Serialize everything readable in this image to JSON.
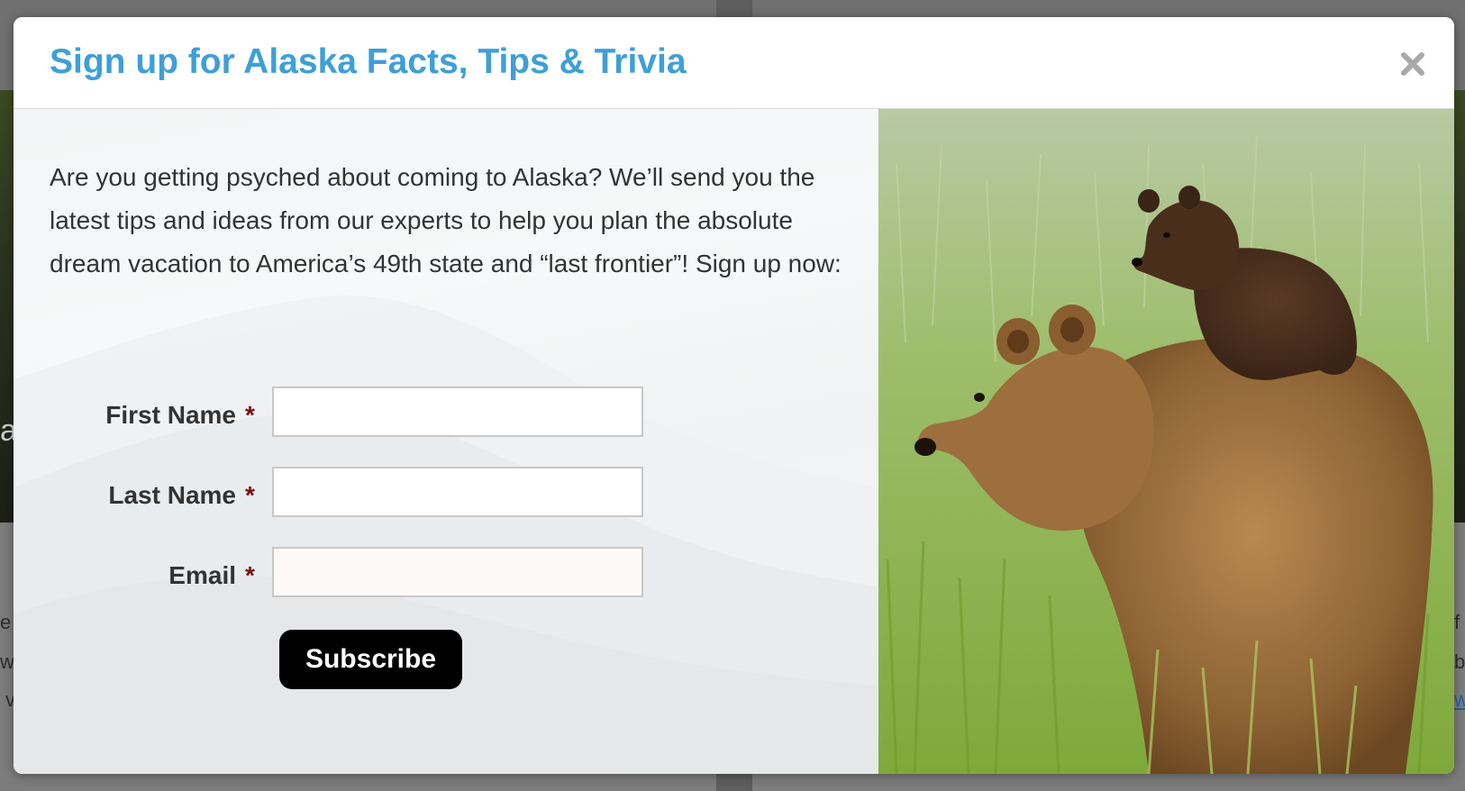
{
  "modal": {
    "title": "Sign up for Alaska Facts, Tips & Trivia",
    "close_icon": "close-icon",
    "intro": "Are you getting psyched about coming to Alaska? We’ll send you the latest tips and ideas from our experts to help you plan the absolute dream vacation to America’s 49th state and “last frontier”! Sign up now:",
    "form": {
      "fields": [
        {
          "label": "First Name",
          "required_mark": "*",
          "value": "",
          "placeholder": ""
        },
        {
          "label": "Last Name",
          "required_mark": "*",
          "value": "",
          "placeholder": ""
        },
        {
          "label": "Email",
          "required_mark": "*",
          "value": "",
          "placeholder": ""
        }
      ],
      "submit_label": "Subscribe"
    },
    "image": {
      "subject": "grizzly-bear-with-cub-image"
    }
  },
  "background_page": {
    "fragments": {
      "hero_letter": "a",
      "left_1": "e",
      "left_2": "w",
      "left_3": "v",
      "right_1": "f",
      "right_2": "b",
      "right_3": "w"
    }
  },
  "colors": {
    "title": "#3e9fd8",
    "required": "#7a1212",
    "button_bg": "#000000",
    "button_text": "#ffffff",
    "overlay": "#7a7a7a"
  }
}
